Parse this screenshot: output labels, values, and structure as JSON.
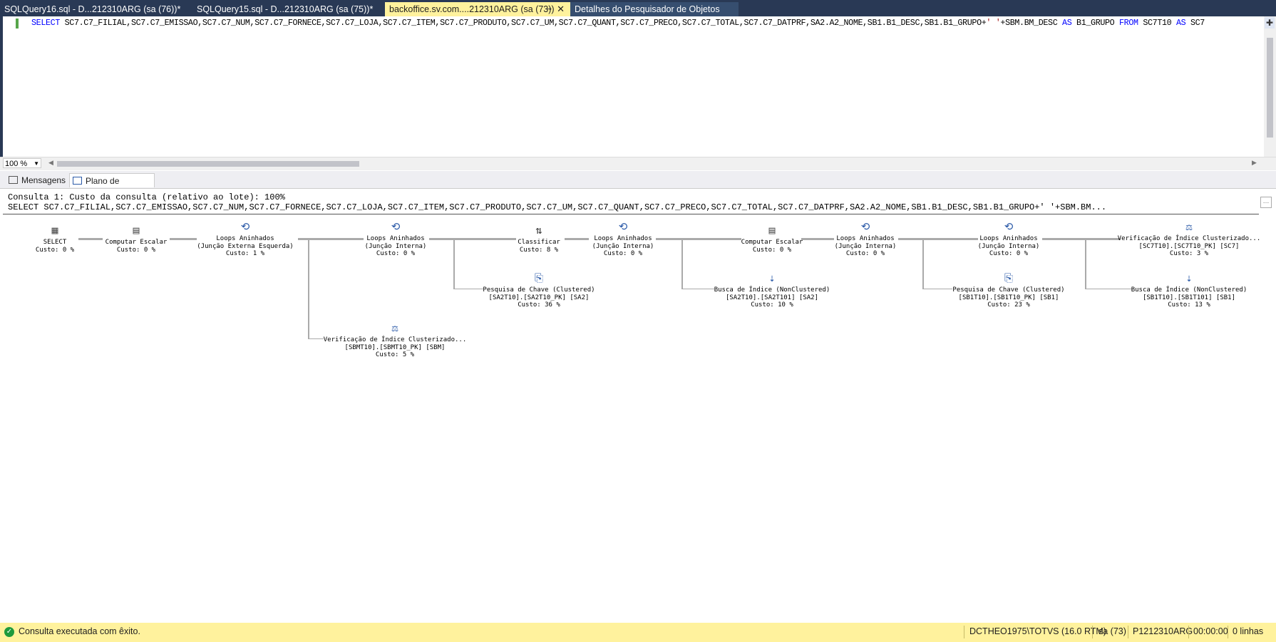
{
  "tabs": [
    {
      "label": "SQLQuery16.sql - D...212310ARG (sa (76))*"
    },
    {
      "label": "SQLQuery15.sql - D...212310ARG (sa (75))*"
    },
    {
      "label": "backoffice.sv.com....212310ARG (sa (73))",
      "pin": "⊸",
      "close": "✕"
    },
    {
      "label": "Detalhes do Pesquisador de Objetos"
    }
  ],
  "editor": {
    "sql_kw1": "SELECT",
    "sql_cols": " SC7.C7_FILIAL,SC7.C7_EMISSAO,SC7.C7_NUM,SC7.C7_FORNECE,SC7.C7_LOJA,SC7.C7_ITEM,SC7.C7_PRODUTO,SC7.C7_UM,SC7.C7_QUANT,SC7.C7_PRECO,SC7.C7_TOTAL,SC7.C7_DATPRF,SA2.A2_NOME,SB1.B1_DESC,SB1.B1_GRUPO+",
    "sql_str": "' '",
    "sql_mid": "+SBM.BM_DESC ",
    "sql_kw2": "AS",
    "sql_alias": " B1_GRUPO ",
    "sql_kw3": "FROM",
    "sql_tbl": " SC7T10 ",
    "sql_kw4": "AS",
    "sql_tail": " SC7",
    "zoom": "100 %"
  },
  "result_tabs": {
    "messages": "Mensagens",
    "plan": "Plano de execução"
  },
  "plan": {
    "query_header": "Consulta 1: Custo da consulta (relativo ao lote): 100%",
    "query_text": "SELECT SC7.C7_FILIAL,SC7.C7_EMISSAO,SC7.C7_NUM,SC7.C7_FORNECE,SC7.C7_LOJA,SC7.C7_ITEM,SC7.C7_PRODUTO,SC7.C7_UM,SC7.C7_QUANT,SC7.C7_PRECO,SC7.C7_TOTAL,SC7.C7_DATPRF,SA2.A2_NOME,SB1.B1_DESC,SB1.B1_GRUPO+' '+SBM.BM...",
    "nodes": {
      "select": {
        "l1": "SELECT",
        "cost": "Custo: 0 %",
        "icon": "table-icon"
      },
      "compute1": {
        "l1": "Computar Escalar",
        "cost": "Custo: 0 %",
        "icon": "compute-scalar-icon"
      },
      "loops1": {
        "l1": "Loops Aninhados",
        "l2": "(Junção Externa Esquerda)",
        "cost": "Custo: 1 %",
        "icon": "nested-loops-icon"
      },
      "loops2": {
        "l1": "Loops Aninhados",
        "l2": "(Junção Interna)",
        "cost": "Custo: 0 %",
        "icon": "nested-loops-icon"
      },
      "sort": {
        "l1": "Classificar",
        "cost": "Custo: 8 %",
        "icon": "sort-icon"
      },
      "loops3": {
        "l1": "Loops Aninhados",
        "l2": "(Junção Interna)",
        "cost": "Custo: 0 %",
        "icon": "nested-loops-icon"
      },
      "compute2": {
        "l1": "Computar Escalar",
        "cost": "Custo: 0 %",
        "icon": "compute-scalar-icon"
      },
      "loops4": {
        "l1": "Loops Aninhados",
        "l2": "(Junção Interna)",
        "cost": "Custo: 0 %",
        "icon": "nested-loops-icon"
      },
      "loops5": {
        "l1": "Loops Aninhados",
        "l2": "(Junção Interna)",
        "cost": "Custo: 0 %",
        "icon": "nested-loops-icon"
      },
      "scan_sc7": {
        "l1": "Verificação de Índice Clusterizado...",
        "l2": "[SC7T10].[SC7T10_PK] [SC7]",
        "cost": "Custo: 3 %",
        "icon": "clustered-index-scan-icon"
      },
      "lookup_sa2": {
        "l1": "Pesquisa de Chave (Clustered)",
        "l2": "[SA2T10].[SA2T10_PK] [SA2]",
        "cost": "Custo: 36 %",
        "icon": "key-lookup-icon"
      },
      "seek_sa2": {
        "l1": "Busca de Índice (NonClustered)",
        "l2": "[SA2T10].[SA2T101] [SA2]",
        "cost": "Custo: 10 %",
        "icon": "index-seek-icon"
      },
      "lookup_sb1": {
        "l1": "Pesquisa de Chave (Clustered)",
        "l2": "[SB1T10].[SB1T10_PK] [SB1]",
        "cost": "Custo: 23 %",
        "icon": "key-lookup-icon"
      },
      "seek_sb1": {
        "l1": "Busca de Índice (NonClustered)",
        "l2": "[SB1T10].[SB1T101] [SB1]",
        "cost": "Custo: 13 %",
        "icon": "index-seek-icon"
      },
      "scan_sbm": {
        "l1": "Verificação de Índice Clusterizado...",
        "l2": "[SBMT10].[SBMT10_PK] [SBM]",
        "cost": "Custo: 5 %",
        "icon": "clustered-index-scan-icon"
      }
    }
  },
  "status": {
    "message": "Consulta executada com êxito.",
    "server": "DCTHEO1975\\TOTVS (16.0 RTM)",
    "user": "sa (73)",
    "db": "P1212310ARG",
    "time": "00:00:00",
    "rows": "0 linhas"
  }
}
